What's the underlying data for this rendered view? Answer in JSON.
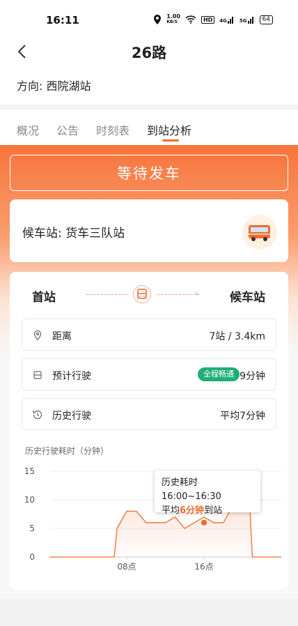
{
  "status_bar": {
    "time": "16:11",
    "net_speed_value": "1.00",
    "net_speed_unit": "KB/S",
    "hd": "HD",
    "signal1": "4G",
    "signal2": "5G",
    "battery": "64"
  },
  "header": {
    "title": "26路",
    "direction_label": "方向:",
    "direction_value": "西院湖站"
  },
  "tabs": [
    "概况",
    "公告",
    "时刻表",
    "到站分析"
  ],
  "active_tab": "到站分析",
  "wait_button": "等待发车",
  "waiting_stop": {
    "label": "候车站:",
    "name": "货车三队站"
  },
  "route": {
    "from": "首站",
    "to": "候车站"
  },
  "rows": [
    {
      "label": "距离",
      "value": "7站 / 3.4km",
      "icon": "location-pin-icon"
    },
    {
      "label": "预计行驶",
      "value": "9分钟",
      "badge": "全程畅通",
      "icon": "bus-icon"
    },
    {
      "label": "历史行驶",
      "value": "平均7分钟",
      "icon": "history-clock-icon"
    }
  ],
  "chart": {
    "title": "历史行驶耗时（分钟）"
  },
  "tooltip": {
    "line1": "历史耗时16:00~16:30",
    "prefix": "平均",
    "highlight": "6分钟",
    "suffix": "到站"
  },
  "colors": {
    "accent": "#f36a2c",
    "badge": "#1fae78"
  },
  "chart_data": {
    "type": "area",
    "title": "历史行驶耗时（分钟）",
    "x": [
      0,
      1,
      2,
      3,
      4,
      5,
      6,
      7,
      8,
      9,
      10,
      11,
      12,
      13,
      14,
      15,
      16,
      17,
      18,
      19,
      20,
      21,
      22,
      23,
      24
    ],
    "xtick_labels": [
      {
        "x": 8,
        "label": "08点"
      },
      {
        "x": 16,
        "label": "16点"
      }
    ],
    "values": [
      0,
      0,
      0,
      0,
      0,
      0,
      0,
      5,
      8,
      8,
      6,
      6,
      6,
      7,
      5,
      6,
      7,
      6,
      6,
      9,
      10,
      0,
      0,
      0,
      0
    ],
    "ylim": [
      0,
      15
    ],
    "yticks": [
      0,
      5,
      10,
      15
    ],
    "highlight_point": {
      "x": 16,
      "y": 6
    },
    "grid": true
  }
}
